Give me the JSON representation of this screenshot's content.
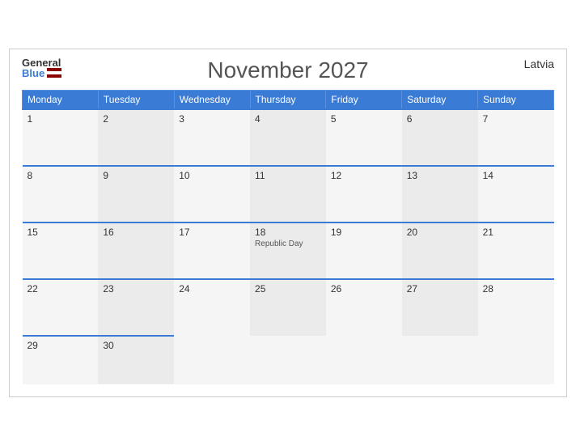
{
  "header": {
    "title": "November 2027",
    "country": "Latvia",
    "logo_general": "General",
    "logo_blue": "Blue"
  },
  "weekdays": [
    "Monday",
    "Tuesday",
    "Wednesday",
    "Thursday",
    "Friday",
    "Saturday",
    "Sunday"
  ],
  "weeks": [
    [
      {
        "day": "1",
        "event": ""
      },
      {
        "day": "2",
        "event": ""
      },
      {
        "day": "3",
        "event": ""
      },
      {
        "day": "4",
        "event": ""
      },
      {
        "day": "5",
        "event": ""
      },
      {
        "day": "6",
        "event": ""
      },
      {
        "day": "7",
        "event": ""
      }
    ],
    [
      {
        "day": "8",
        "event": ""
      },
      {
        "day": "9",
        "event": ""
      },
      {
        "day": "10",
        "event": ""
      },
      {
        "day": "11",
        "event": ""
      },
      {
        "day": "12",
        "event": ""
      },
      {
        "day": "13",
        "event": ""
      },
      {
        "day": "14",
        "event": ""
      }
    ],
    [
      {
        "day": "15",
        "event": ""
      },
      {
        "day": "16",
        "event": ""
      },
      {
        "day": "17",
        "event": ""
      },
      {
        "day": "18",
        "event": "Republic Day"
      },
      {
        "day": "19",
        "event": ""
      },
      {
        "day": "20",
        "event": ""
      },
      {
        "day": "21",
        "event": ""
      }
    ],
    [
      {
        "day": "22",
        "event": ""
      },
      {
        "day": "23",
        "event": ""
      },
      {
        "day": "24",
        "event": ""
      },
      {
        "day": "25",
        "event": ""
      },
      {
        "day": "26",
        "event": ""
      },
      {
        "day": "27",
        "event": ""
      },
      {
        "day": "28",
        "event": ""
      }
    ],
    [
      {
        "day": "29",
        "event": ""
      },
      {
        "day": "30",
        "event": ""
      },
      {
        "day": "",
        "event": ""
      },
      {
        "day": "",
        "event": ""
      },
      {
        "day": "",
        "event": ""
      },
      {
        "day": "",
        "event": ""
      },
      {
        "day": "",
        "event": ""
      }
    ]
  ]
}
